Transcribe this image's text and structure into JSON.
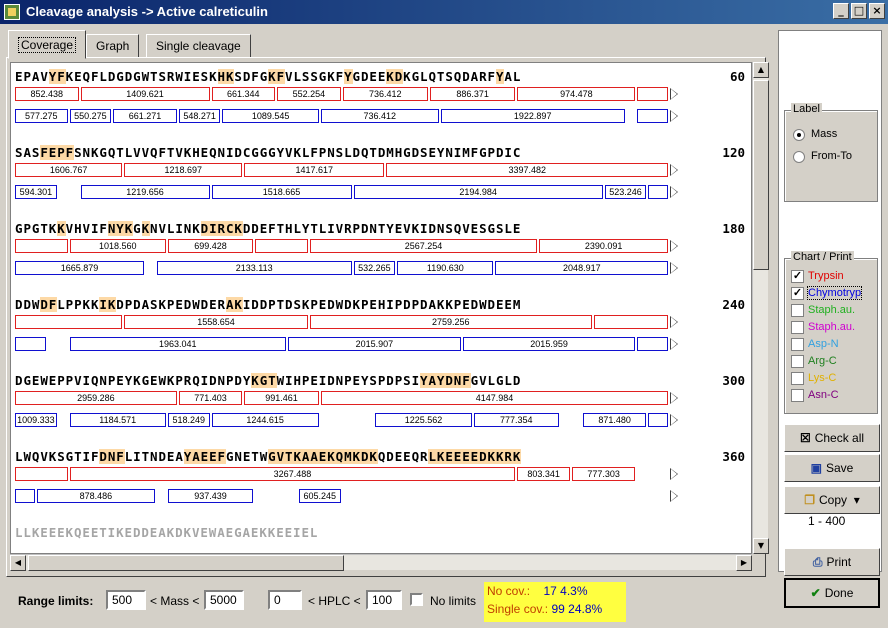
{
  "window": {
    "title": "Cleavage analysis -> Active calreticulin",
    "min": "_",
    "max": "□",
    "close": "×"
  },
  "tabs": [
    "Coverage",
    "Graph",
    "Single cleavage"
  ],
  "blocks": [
    {
      "seq": "EPAVYFKEQFLDGDGWTSRWIESKHKSDFGKFVLSSGKFYGDEEKDKGLQTSQDARFYAL",
      "highlight": [
        4,
        5,
        24,
        25,
        30,
        31,
        39,
        44,
        45,
        57
      ],
      "num": "60",
      "red": [
        [
          "852.438",
          0,
          6
        ],
        [
          "1409.621",
          6,
          18
        ],
        [
          "661.344",
          18,
          24
        ],
        [
          "552.254",
          24,
          30
        ],
        [
          "736.412",
          30,
          38
        ],
        [
          "886.371",
          38,
          46
        ],
        [
          "974.478",
          46,
          57
        ],
        [
          "",
          57,
          60
        ]
      ],
      "blue": [
        [
          "577.275",
          0,
          5
        ],
        [
          "550.275",
          5,
          9
        ],
        [
          "661.271",
          9,
          15
        ],
        [
          "548.271",
          15,
          19
        ],
        [
          "1089.545",
          19,
          28
        ],
        [
          "736.412",
          28,
          39
        ],
        [
          "1922.897",
          39,
          56
        ],
        [
          "",
          57,
          60
        ]
      ]
    },
    {
      "seq": "SASFEPFSNKGQTLVVQFTVKHEQNIDCGGGYVKLFPNSLDQTDMHGDSEYNIMFGPDIC",
      "highlight": [
        3,
        4,
        5,
        6
      ],
      "num": "120",
      "red": [
        [
          "1606.767",
          0,
          10
        ],
        [
          "1218.697",
          10,
          21
        ],
        [
          "1417.617",
          21,
          34
        ],
        [
          "3397.482",
          34,
          60
        ]
      ],
      "blue": [
        [
          "594.301",
          0,
          4
        ],
        [
          "1219.656",
          6,
          18
        ],
        [
          "1518.665",
          18,
          31
        ],
        [
          "2194.984",
          31,
          54
        ],
        [
          "523.246",
          54,
          58
        ],
        [
          "",
          58,
          60
        ]
      ]
    },
    {
      "seq": "GPGTKKVHVIFNYKGKNVLINKDIRCKDDEFTHLYTLIVRPDNTYEVKIDNSQVESGSLE",
      "highlight": [
        5,
        11,
        12,
        13,
        15,
        22,
        23,
        24,
        25,
        26
      ],
      "num": "180",
      "red": [
        [
          "",
          0,
          5
        ],
        [
          "1018.560",
          5,
          14
        ],
        [
          "699.428",
          14,
          22
        ],
        [
          "",
          22,
          27
        ],
        [
          "2567.254",
          27,
          48
        ],
        [
          "2390.091",
          48,
          60
        ]
      ],
      "blue": [
        [
          "1665.879",
          0,
          12
        ],
        [
          "2133.113",
          13,
          31
        ],
        [
          "532.265",
          31,
          35
        ],
        [
          "1190.630",
          35,
          44
        ],
        [
          "2048.917",
          44,
          60
        ]
      ]
    },
    {
      "seq": "DDWDFLPPKKIKDPDASKPEDWDERAKIDDPTDSKPEDWDKPEHIPDPDAKKPEDWDEEM",
      "highlight": [
        3,
        4,
        10,
        11,
        25,
        26
      ],
      "num": "240",
      "red": [
        [
          "",
          0,
          10
        ],
        [
          "1558.654",
          10,
          27
        ],
        [
          "2759.256",
          27,
          53
        ],
        [
          "",
          53,
          60
        ]
      ],
      "blue": [
        [
          "",
          0,
          3
        ],
        [
          "1963.041",
          5,
          25
        ],
        [
          "2015.907",
          25,
          41
        ],
        [
          "2015.959",
          41,
          57
        ],
        [
          "",
          57,
          60
        ]
      ]
    },
    {
      "seq": "DGEWEPPVIQNPEYKGEWKPRQIDNPDYKGTWIHPEIDNPEYSPDPSIYAYDNFGVLGLD",
      "highlight": [
        28,
        29,
        30,
        48,
        49,
        50,
        51,
        52,
        53
      ],
      "num": "300",
      "red": [
        [
          "2959.286",
          0,
          15
        ],
        [
          "771.403",
          15,
          21
        ],
        [
          "991.461",
          21,
          28
        ],
        [
          "4147.984",
          28,
          60
        ]
      ],
      "blue": [
        [
          "1009.333",
          0,
          4
        ],
        [
          "1184.571",
          5,
          14
        ],
        [
          "518.249",
          14,
          18
        ],
        [
          "1244.615",
          18,
          28
        ],
        [
          "1225.562",
          33,
          42
        ],
        [
          "777.354",
          42,
          50
        ],
        [
          "871.480",
          52,
          58
        ],
        [
          "",
          58,
          60
        ]
      ]
    },
    {
      "seq": "LWQVKSGTIFDNFLITNDEAYAEEFGNETWGVTKAAEKQMKDKQDEEQRLKEEEEDKKRK",
      "highlight": [
        10,
        11,
        12,
        20,
        21,
        22,
        23,
        24,
        30,
        31,
        32,
        33,
        34,
        35,
        36,
        37,
        38,
        39,
        40,
        41,
        42,
        49,
        50,
        51,
        52,
        53,
        54,
        55,
        56,
        57,
        58,
        59
      ],
      "num": "360",
      "red": [
        [
          "",
          0,
          5
        ],
        [
          "3267.488",
          5,
          46
        ],
        [
          "803.341",
          46,
          51
        ],
        [
          "777.303",
          51,
          57
        ]
      ],
      "blue": [
        [
          "",
          0,
          2
        ],
        [
          "878.486",
          2,
          13
        ],
        [
          "937.439",
          14,
          22
        ],
        [
          "605.245",
          26,
          30
        ]
      ]
    }
  ],
  "partial_seq": "LLKEEEKQEETIKEDDEAKDKVEWAEGAEKKEEIEL",
  "bottom": {
    "range_label": "Range limits:",
    "mass_min": "500",
    "mass_op": "< Mass <",
    "mass_max": "5000",
    "hplc_min": "0",
    "hplc_op": "< HPLC <",
    "hplc_max": "100",
    "nolimits_label": "No limits",
    "nocov_label": "No cov.:",
    "nocov_value": "17  4.3%",
    "single_label": "Single cov.:",
    "single_value": "99  24.8%"
  },
  "label_group": {
    "legend": "Label",
    "options": [
      "Mass",
      "From-To"
    ],
    "selected": 0
  },
  "chart_group": {
    "legend": "Chart / Print",
    "items": [
      {
        "label": "Trypsin",
        "checked": true,
        "color": "#e00000"
      },
      {
        "label": "Chymotryp",
        "checked": true,
        "color": "#0000e0"
      },
      {
        "label": "Staph.au.",
        "checked": false,
        "color": "#20b020"
      },
      {
        "label": "Staph.au.",
        "checked": false,
        "color": "#d000d0"
      },
      {
        "label": "Asp-N",
        "checked": false,
        "color": "#30a0e0"
      },
      {
        "label": "Arg-C",
        "checked": false,
        "color": "#208020"
      },
      {
        "label": "Lys-C",
        "checked": false,
        "color": "#e0b000"
      },
      {
        "label": "Asn-C",
        "checked": false,
        "color": "#800080"
      }
    ]
  },
  "buttons": {
    "check_all": "Check all",
    "save": "Save",
    "copy": "Copy",
    "range": "1 - 400",
    "print": "Print",
    "done": "Done"
  }
}
